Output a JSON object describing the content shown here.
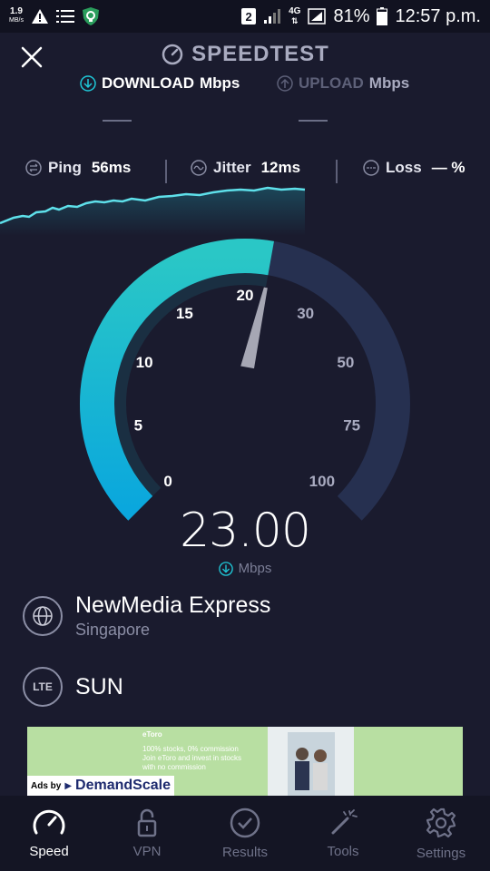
{
  "status_bar": {
    "net_speed_value": "1.9",
    "net_speed_unit": "MB/s",
    "sim_slot": "2",
    "network_type": "4G",
    "battery": "81%",
    "time": "12:57 p.m."
  },
  "header": {
    "title": "SPEEDTEST"
  },
  "modes": {
    "download_label": "DOWNLOAD",
    "download_unit": "Mbps",
    "upload_label": "UPLOAD",
    "upload_unit": "Mbps"
  },
  "stats": {
    "ping_label": "Ping",
    "ping_value": "56ms",
    "jitter_label": "Jitter",
    "jitter_value": "12ms",
    "loss_label": "Loss",
    "loss_value": "— %"
  },
  "gauge": {
    "ticks": [
      "0",
      "5",
      "10",
      "15",
      "20",
      "30",
      "50",
      "75",
      "100"
    ],
    "current_value": 23.0,
    "fill_color": "#1fb8d0",
    "track_color": "#263050"
  },
  "readout": {
    "value": "23.00",
    "unit": "Mbps"
  },
  "server": {
    "name": "NewMedia Express",
    "location": "Singapore"
  },
  "provider": {
    "badge": "LTE",
    "name": "SUN"
  },
  "ad": {
    "heading": "eToro",
    "line1": "100% stocks, 0% commission",
    "line2": "Join eToro and invest in stocks",
    "line3": "with no commission",
    "ads_by": "Ads by",
    "brand": "DemandScale"
  },
  "navbar": {
    "items": [
      {
        "label": "Speed"
      },
      {
        "label": "VPN"
      },
      {
        "label": "Results"
      },
      {
        "label": "Tools"
      },
      {
        "label": "Settings"
      }
    ]
  },
  "colors": {
    "accent": "#1fc8d8",
    "background": "#1a1b2e"
  }
}
